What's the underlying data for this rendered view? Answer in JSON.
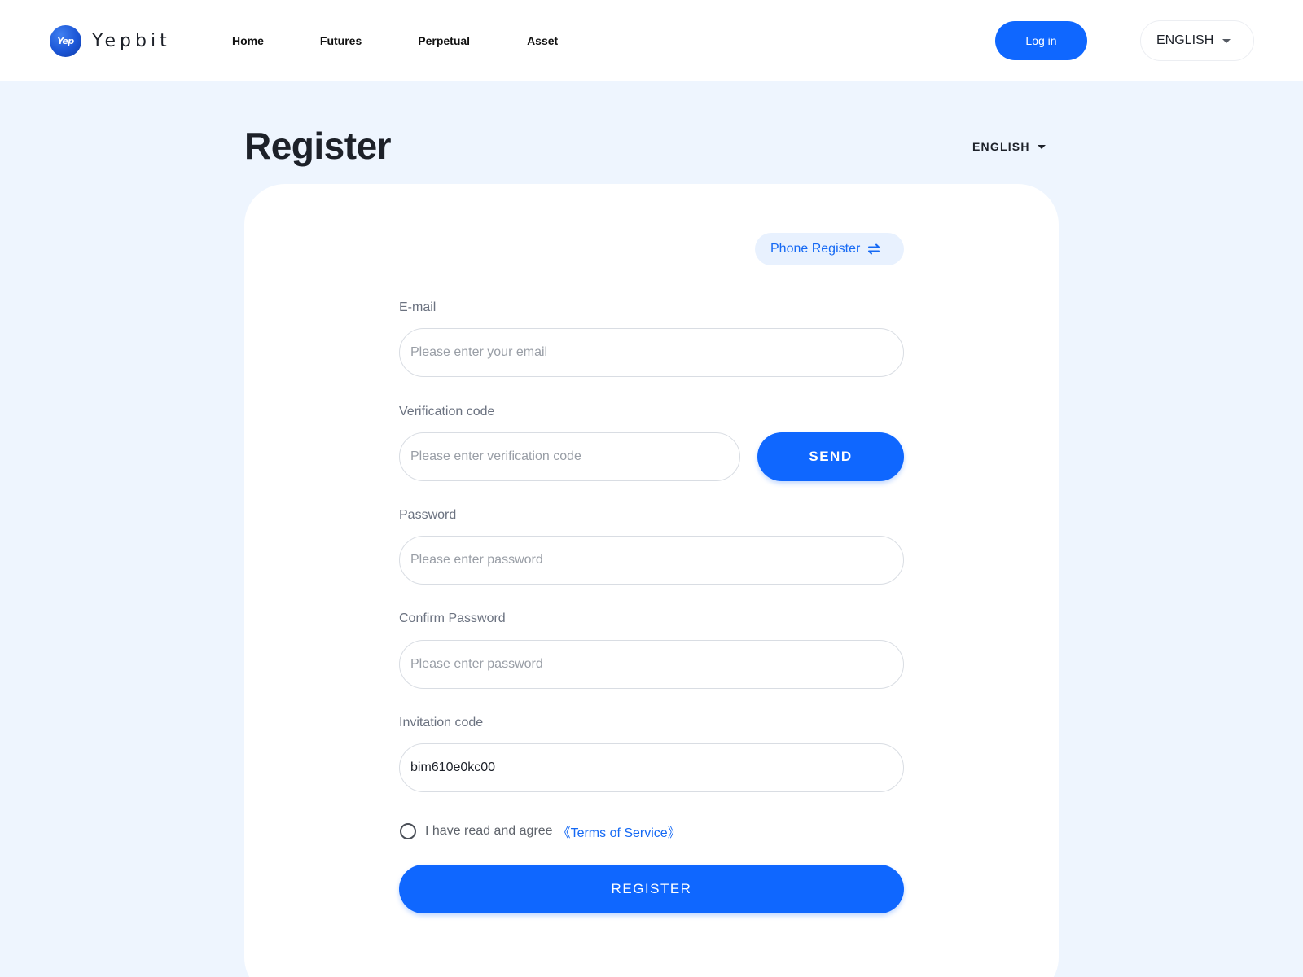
{
  "brand": {
    "logo_mark": "Yep",
    "name": "Yepbit"
  },
  "nav": {
    "items": [
      {
        "label": "Home"
      },
      {
        "label": "Futures"
      },
      {
        "label": "Perpetual"
      },
      {
        "label": "Asset"
      }
    ],
    "login_label": "Log in",
    "language": "ENGLISH"
  },
  "page": {
    "title": "Register",
    "language": "ENGLISH"
  },
  "form": {
    "switch_label": "Phone Register",
    "email": {
      "label": "E-mail",
      "placeholder": "Please enter your email",
      "value": ""
    },
    "verification": {
      "label": "Verification code",
      "placeholder": "Please enter verification code",
      "value": "",
      "send_label": "SEND"
    },
    "password": {
      "label": "Password",
      "placeholder": "Please enter password",
      "value": ""
    },
    "confirm_password": {
      "label": "Confirm Password",
      "placeholder": "Please enter password",
      "value": ""
    },
    "invitation": {
      "label": "Invitation code",
      "placeholder": "",
      "value": "bim610e0kc00"
    },
    "agree_text": "I have read and agree",
    "terms_label": "《Terms of Service》",
    "agreed": false,
    "submit_label": "REGISTER"
  },
  "icons": {
    "swap": "swap-arrows-icon",
    "caret": "caret-down-icon"
  },
  "colors": {
    "accent": "#0f67ff",
    "link": "#1569f4",
    "page_bg": "#eef5fe",
    "pill_bg": "#e8f1fe"
  }
}
